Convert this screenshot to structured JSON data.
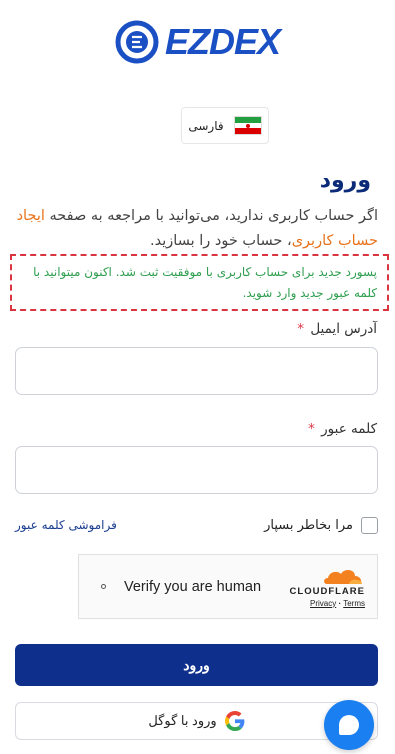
{
  "brand": {
    "logo_text": "EZDEX"
  },
  "language": {
    "label": "فارسی",
    "flag_icon": "iran-flag-icon"
  },
  "login": {
    "title": "ورود",
    "intro_before": "اگر حساب کاربری ندارید، می‌توانید با مراجعه به صفحه ",
    "intro_link": "ایجاد حساب کاربری",
    "intro_after": "، حساب خود را بسازید.",
    "success_message": "پسورد جدید برای حساب کاربری با موفقیت ثبت شد. اکنون میتوانید با کلمه عبور جدید وارد شوید."
  },
  "form": {
    "email_label": "آدرس ایمیل",
    "email_value": "",
    "password_label": "کلمه عبور",
    "password_value": "",
    "required_mark": "*",
    "remember_label": "مرا بخاطر بسپار",
    "forgot_label": "فراموشی کلمه عبور"
  },
  "captcha": {
    "text": "Verify you are human",
    "provider": "CLOUDFLARE",
    "privacy": "Privacy",
    "separator": "·",
    "terms": "Terms"
  },
  "buttons": {
    "login_label": "ورود",
    "google_label": "ورود با گوگل"
  },
  "colors": {
    "primary": "#0f2f8c",
    "accent_link": "#e8731b",
    "success_text": "#2e9e4f",
    "alert_border": "#d9343f",
    "chat": "#1a7ff0"
  }
}
